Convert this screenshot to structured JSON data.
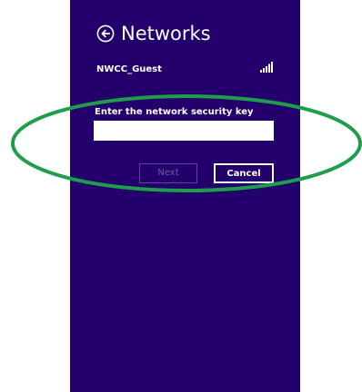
{
  "header": {
    "title": "Networks",
    "back_icon": "back-arrow-circle-icon"
  },
  "network": {
    "name": "NWCC_Guest",
    "signal_icon": "signal-strength-icon"
  },
  "security_key": {
    "label": "Enter the network security key",
    "value": "",
    "placeholder": ""
  },
  "buttons": {
    "next_label": "Next",
    "cancel_label": "Cancel"
  },
  "colors": {
    "panel_background": "#23006b",
    "text": "#ffffff",
    "annotation": "#1e9e4a"
  }
}
